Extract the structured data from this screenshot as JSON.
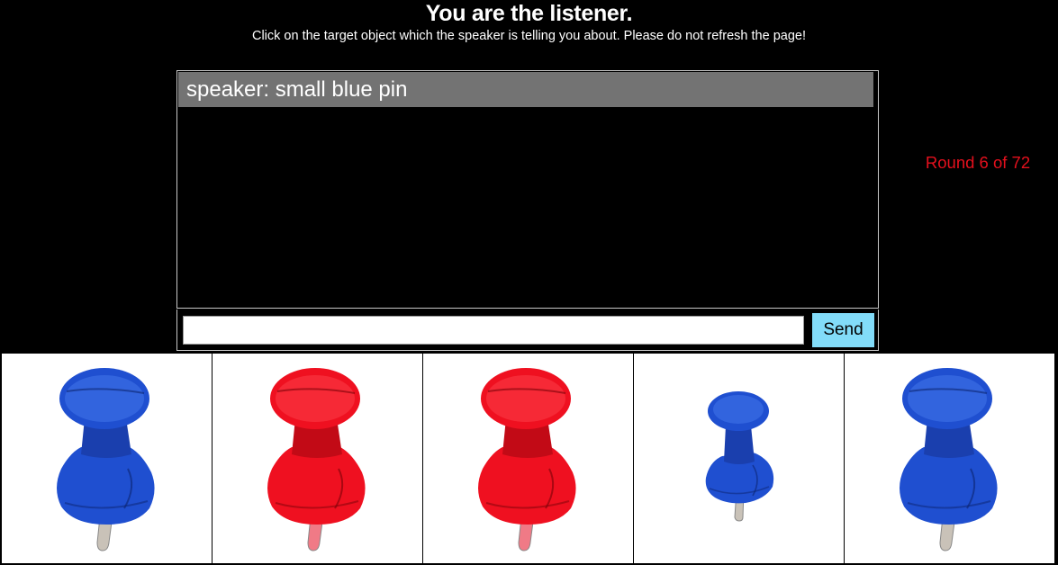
{
  "header": {
    "title": "You are the listener.",
    "instructions": "Click on the target object which the speaker is telling you about. Please do not refresh the page!"
  },
  "chat": {
    "messages": [
      {
        "text": "speaker: small blue pin"
      }
    ],
    "input_value": "",
    "send_label": "Send"
  },
  "status": {
    "round_text": "Round 6 of 72"
  },
  "colors": {
    "background": "#000000",
    "message_bar": "#737373",
    "send_button": "#82dcf9",
    "round_text": "#e4101d",
    "pin_blue": "#1f4fd0",
    "pin_red": "#ef1020"
  },
  "objects": [
    {
      "icon": "blue-pushpin-icon",
      "color": "blue",
      "size": "large"
    },
    {
      "icon": "red-pushpin-icon",
      "color": "red",
      "size": "large"
    },
    {
      "icon": "red-pushpin-icon",
      "color": "red",
      "size": "large"
    },
    {
      "icon": "blue-pushpin-icon",
      "color": "blue",
      "size": "small"
    },
    {
      "icon": "blue-pushpin-icon",
      "color": "blue",
      "size": "large"
    }
  ]
}
